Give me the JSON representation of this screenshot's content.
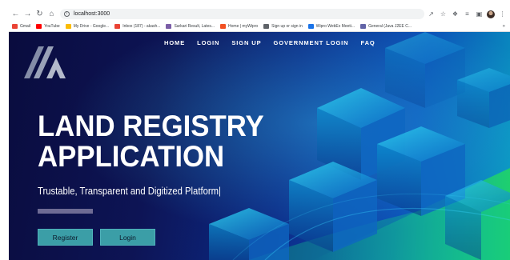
{
  "browser": {
    "url": "localhost:3000",
    "bookmarks": [
      {
        "label": "Gmail",
        "icon": "gmail-icon",
        "color": "#ea4335"
      },
      {
        "label": "YouTube",
        "icon": "youtube-icon",
        "color": "#ff0000"
      },
      {
        "label": "My Drive - Google...",
        "icon": "google-drive-icon",
        "color": "#fbbc04"
      },
      {
        "label": "Inbox (187) - akash...",
        "icon": "gmail-icon",
        "color": "#ea4335"
      },
      {
        "label": "Sarkari Result, Lates...",
        "icon": "globe-icon",
        "color": "#7b5ea7"
      },
      {
        "label": "Home | myWipro",
        "icon": "windows-icon",
        "color": "#f25022"
      },
      {
        "label": "Sign up or sign in",
        "icon": "globe-icon",
        "color": "#5f6368"
      },
      {
        "label": "Wipro WebEx Meeti...",
        "icon": "webex-icon",
        "color": "#1a73e8"
      },
      {
        "label": "General (Java J2EE C...",
        "icon": "teams-icon",
        "color": "#6264a7"
      }
    ],
    "more_label": "»"
  },
  "nav": {
    "items": [
      "HOME",
      "LOGIN",
      "SIGN UP",
      "GOVERNMENT LOGIN",
      "FAQ"
    ]
  },
  "hero": {
    "title_line1": "LAND REGISTRY",
    "title_line2": "APPLICATION",
    "tagline": "Trustable, Transparent and Digitized Platform|",
    "register_label": "Register",
    "login_label": "Login"
  },
  "colors": {
    "page_bg_dark": "#0a0c3e",
    "accent_cyan": "#0aa0c2",
    "button_teal": "#3b9ea7"
  }
}
